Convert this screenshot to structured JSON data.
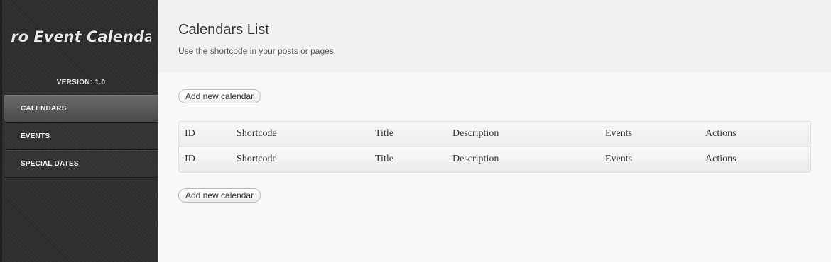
{
  "sidebar": {
    "logo_text": "Pro Event Calendar",
    "version": "VERSION: 1.0",
    "items": [
      {
        "label": "CALENDARS"
      },
      {
        "label": "EVENTS"
      },
      {
        "label": "SPECIAL DATES"
      }
    ]
  },
  "header": {
    "title": "Calendars List",
    "subtitle": "Use the shortcode in your posts or pages."
  },
  "buttons": {
    "add_new_top": "Add new calendar",
    "add_new_bottom": "Add new calendar"
  },
  "table": {
    "header": [
      "ID",
      "Shortcode",
      "Title",
      "Description",
      "Events",
      "Actions"
    ],
    "footer": [
      "ID",
      "Shortcode",
      "Title",
      "Description",
      "Events",
      "Actions"
    ]
  }
}
